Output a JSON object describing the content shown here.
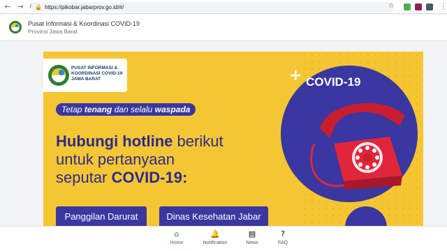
{
  "browser": {
    "url": "https://pikobar.jabarprov.go.id/#/",
    "back_icon": "arrow-left-icon",
    "forward_icon": "arrow-right-icon",
    "reload_icon": "reload-icon",
    "back_glyph": "←",
    "forward_glyph": "→",
    "reload_glyph": "⟳",
    "lock_glyph": "🔒",
    "star_glyph": "☆"
  },
  "header": {
    "title": "Pusat Informasi & Koordinasi COVID-19",
    "subtitle": "Provinsi Jawa Barat"
  },
  "banner": {
    "logo_text": "PUSAT INFORMASI & KOORDINASI COVID-19 JAWA BARAT",
    "tagline_pre": "Tetap ",
    "tagline_b1": "tenang",
    "tagline_mid": " dan selalu ",
    "tagline_b2": "waspada",
    "headline_b": "Hubungi hotline",
    "headline_rest1": " berikut",
    "headline_line2": "untuk pertanyaan",
    "headline_line3_pre": "seputar ",
    "headline_line3_b": "COVID-19:",
    "covid_label": "COVID-19",
    "plus_glyph": "+",
    "buttons": [
      {
        "label": "Panggilan Darurat"
      },
      {
        "label": "Dinas Kesehatan Jabar"
      }
    ]
  },
  "bottom_nav": [
    {
      "label": "Home",
      "icon": "home-icon",
      "glyph": "⌂",
      "active": true
    },
    {
      "label": "Notification",
      "icon": "bell-icon",
      "glyph": "🔔",
      "active": false
    },
    {
      "label": "News",
      "icon": "news-icon",
      "glyph": "▤",
      "active": false
    },
    {
      "label": "FAQ",
      "icon": "help-icon",
      "glyph": "?",
      "active": false
    }
  ],
  "colors": {
    "banner_bg": "#f5c633",
    "brand_blue": "#3a37a0",
    "phone_red": "#e0263a",
    "active_green": "#2e7d32"
  }
}
